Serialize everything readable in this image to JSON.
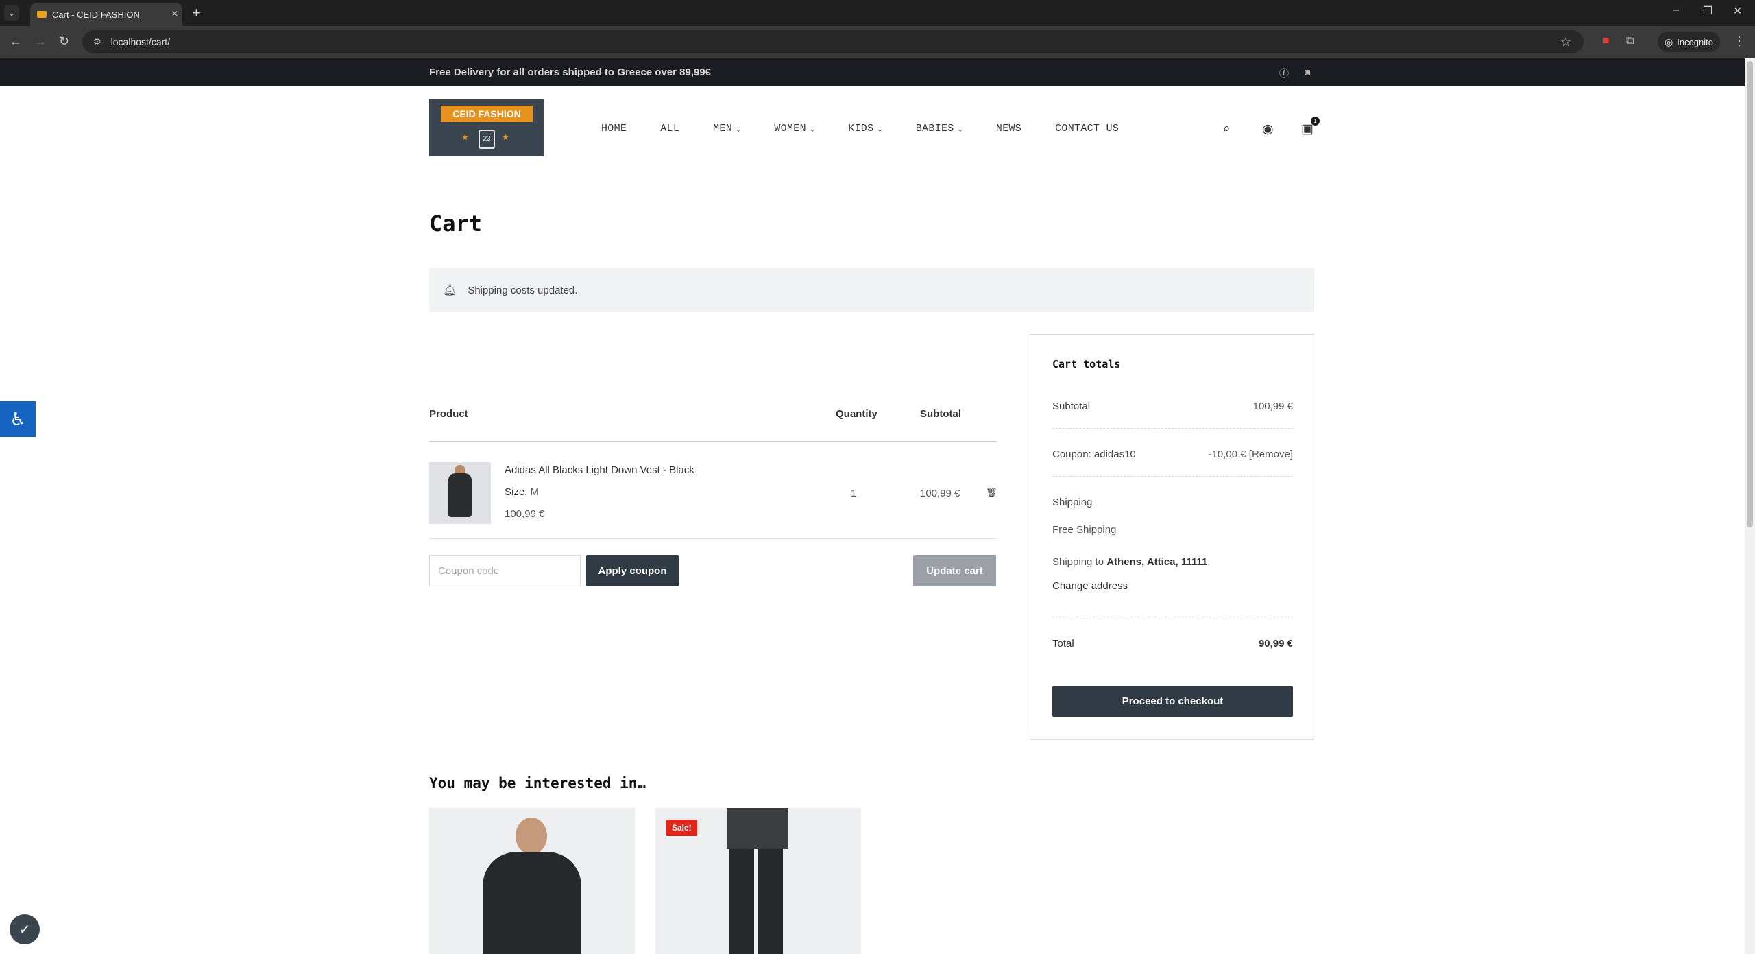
{
  "browser": {
    "tab_title": "Cart - CEID FASHION",
    "url": "localhost/cart/",
    "incognito_label": "Incognito"
  },
  "topbar": {
    "promo": "Free Delivery for all orders shipped to Greece over 89,99€"
  },
  "logo": {
    "text": "CEID FASHION",
    "jersey_number": "23"
  },
  "nav": {
    "items": [
      "HOME",
      "ALL",
      "MEN",
      "WOMEN",
      "KIDS",
      "BABIES",
      "NEWS",
      "CONTACT US"
    ],
    "cart_count": "1"
  },
  "page_title": "Cart",
  "notice": "Shipping costs updated.",
  "cart": {
    "headers": {
      "product": "Product",
      "quantity": "Quantity",
      "subtotal": "Subtotal"
    },
    "item": {
      "name": "Adidas All Blacks Light Down Vest - Black",
      "size_label": "Size:",
      "size_value": "M",
      "price": "100,99 €",
      "quantity": "1",
      "subtotal": "100,99 €"
    },
    "coupon_placeholder": "Coupon code",
    "apply_coupon": "Apply coupon",
    "update_cart": "Update cart"
  },
  "totals": {
    "title": "Cart totals",
    "subtotal_label": "Subtotal",
    "subtotal_value": "100,99 €",
    "coupon_label": "Coupon: adidas10",
    "coupon_value": "-10,00 €",
    "coupon_remove": "[Remove]",
    "shipping_label": "Shipping",
    "shipping_method": "Free Shipping",
    "shipping_to_prefix": "Shipping to",
    "shipping_to_place": "Athens, Attica, 11111",
    "change_address": "Change address",
    "total_label": "Total",
    "total_value": "90,99 €",
    "checkout": "Proceed to checkout"
  },
  "related": {
    "title": "You may be interested in…",
    "sale_badge": "Sale!"
  }
}
